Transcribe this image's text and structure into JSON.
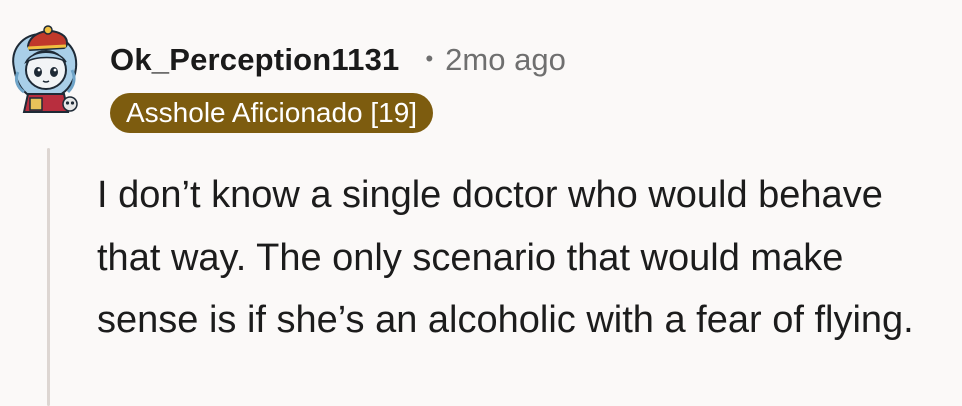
{
  "comment": {
    "author": "Ok_Perception1131",
    "separator": "•",
    "timestamp": "2mo ago",
    "flair": "Asshole Aficionado [19]",
    "body": "I don’t know a single doctor who would behave that way. The only scenario that would make sense is if she’s an alcoholic with a fear of flying."
  },
  "colors": {
    "background": "#fbf9f8",
    "flair_background": "#7d5c0f",
    "flair_text": "#ffffff",
    "meta_text": "#6f6f6f",
    "thread_line": "#ddd6d2"
  },
  "icons": {
    "avatar": "snoo-avatar-icon"
  }
}
